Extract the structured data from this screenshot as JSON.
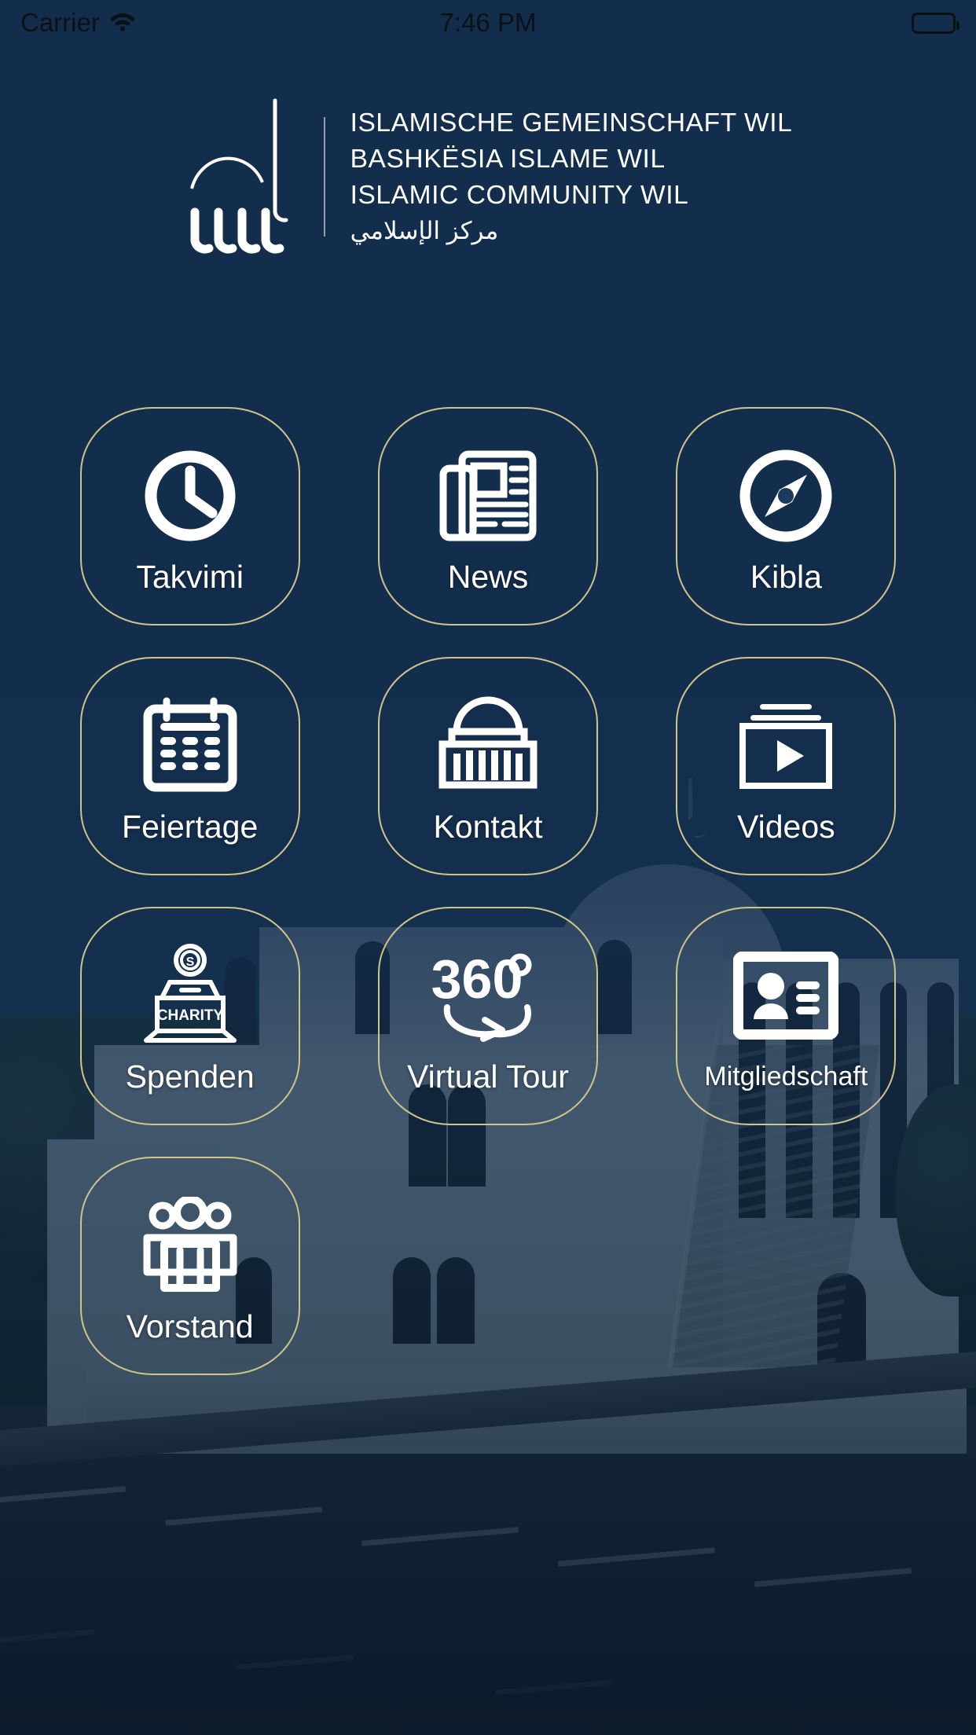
{
  "status_bar": {
    "carrier": "Carrier",
    "wifi_icon": "wifi-icon",
    "time": "7:46 PM",
    "battery_icon": "battery-full-icon"
  },
  "header": {
    "logo_icon": "mosque-logo-icon",
    "title_de": "ISLAMISCHE GEMEINSCHAFT WIL",
    "title_sq": "BASHKËSIA ISLAME WIL",
    "title_en": "ISLAMIC COMMUNITY WIL",
    "title_ar": "مركز الإسلامي"
  },
  "colors": {
    "background_navy": "#16304f",
    "tile_border_gold": "#cfc58a",
    "icon_white": "#ffffff",
    "status_text": "#0c1116"
  },
  "grid": {
    "tiles": [
      {
        "id": "takvimi",
        "label": "Takvimi",
        "icon": "clock-icon"
      },
      {
        "id": "news",
        "label": "News",
        "icon": "newspaper-icon"
      },
      {
        "id": "kibla",
        "label": "Kibla",
        "icon": "compass-icon"
      },
      {
        "id": "feiertage",
        "label": "Feiertage",
        "icon": "calendar-icon"
      },
      {
        "id": "kontakt",
        "label": "Kontakt",
        "icon": "mosque-building-icon"
      },
      {
        "id": "videos",
        "label": "Videos",
        "icon": "video-play-icon"
      },
      {
        "id": "spenden",
        "label": "Spenden",
        "icon": "charity-box-icon",
        "icon_text": "CHARITY"
      },
      {
        "id": "virtual-tour",
        "label": "Virtual Tour",
        "icon": "360-degree-icon",
        "icon_text": "360"
      },
      {
        "id": "mitgliedschaft",
        "label": "Mitgliedschaft",
        "icon": "id-card-icon"
      },
      {
        "id": "vorstand",
        "label": "Vorstand",
        "icon": "group-people-icon"
      }
    ]
  },
  "background": {
    "scene": "mosque-building-photo"
  }
}
